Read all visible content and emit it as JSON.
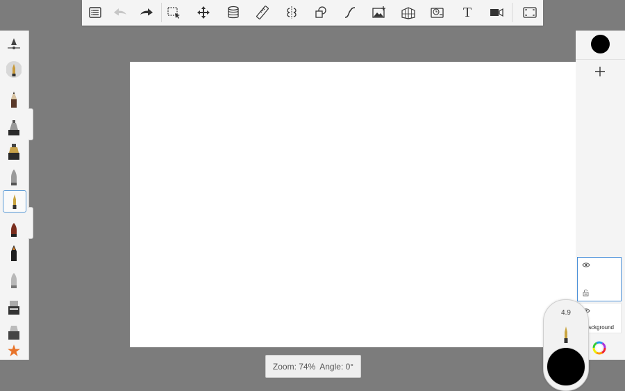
{
  "app": {
    "canvas_color": "#ffffff",
    "background_color": "#7c7c7c",
    "accent_color": "#4a90d9"
  },
  "toolbar": {
    "items": [
      {
        "icon": "menu-list-icon"
      },
      {
        "icon": "undo-icon"
      },
      {
        "icon": "redo-icon"
      },
      {
        "icon": "selection-icon"
      },
      {
        "icon": "transform-move-icon"
      },
      {
        "icon": "layer-stack-icon"
      },
      {
        "icon": "ruler-icon"
      },
      {
        "icon": "symmetry-icon"
      },
      {
        "icon": "shapes-icon"
      },
      {
        "icon": "curve-icon"
      },
      {
        "icon": "add-image-icon"
      },
      {
        "icon": "perspective-grid-icon"
      },
      {
        "icon": "time-lapse-icon"
      },
      {
        "icon": "text-icon"
      },
      {
        "icon": "video-record-icon"
      },
      {
        "icon": "fullscreen-icon"
      }
    ],
    "text_glyph": "T"
  },
  "left_palette": {
    "brushes": [
      {
        "name": "brush-settings-slider-icon"
      },
      {
        "name": "brush-pen-round-icon"
      },
      {
        "name": "brush-pencil-icon"
      },
      {
        "name": "brush-marker-chisel-icon"
      },
      {
        "name": "brush-ink-wide-icon"
      },
      {
        "name": "brush-airbrush-icon"
      },
      {
        "name": "brush-ballpoint-selected-icon",
        "selected": true
      },
      {
        "name": "brush-paintbrush-icon"
      },
      {
        "name": "brush-felt-pen-icon"
      },
      {
        "name": "brush-eraser-soft-icon"
      },
      {
        "name": "brush-flat-marker-icon"
      },
      {
        "name": "brush-texture-icon"
      },
      {
        "name": "favorites-star-icon"
      }
    ]
  },
  "right_panel": {
    "current_color": "#000000",
    "layers": [
      {
        "name": "",
        "selected": true
      },
      {
        "name": "Background",
        "selected": false
      }
    ]
  },
  "status": {
    "zoom_text": "Zoom: 74%",
    "angle_text": "Angle: 0°"
  },
  "brush_puck": {
    "size_value": "4.9",
    "color": "#000000"
  }
}
